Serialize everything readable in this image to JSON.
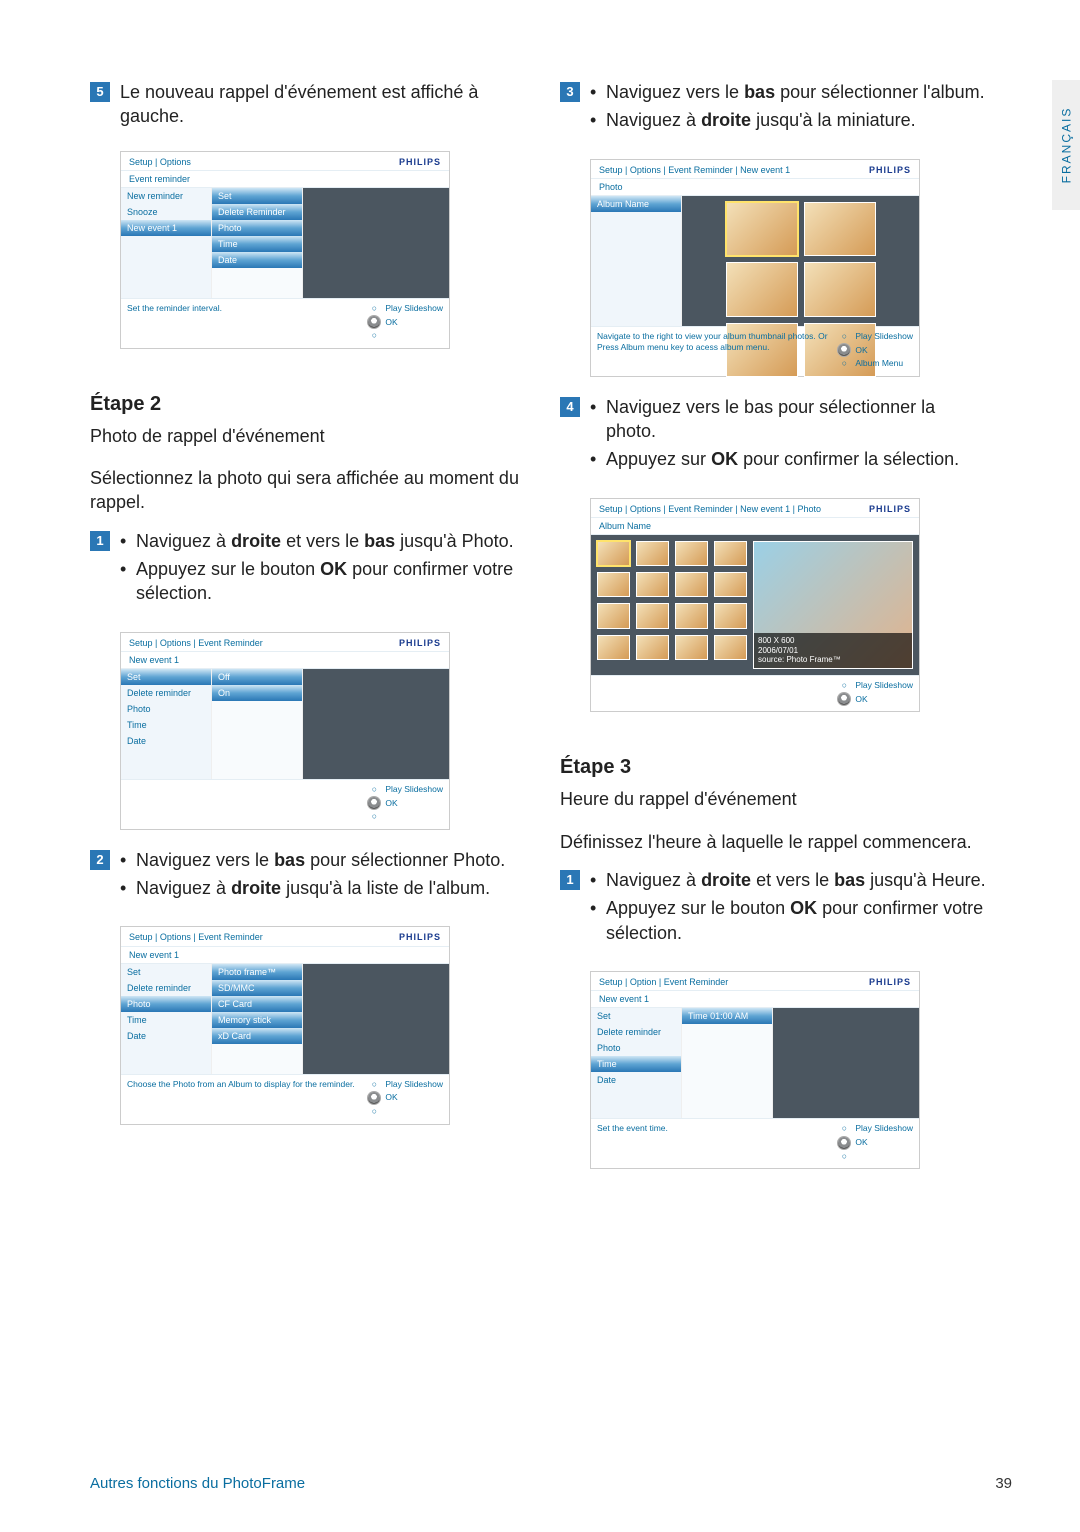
{
  "language_tab": "FRANÇAIS",
  "brand": "PHILIPS",
  "footer": {
    "left": "Autres fonctions du PhotoFrame",
    "page": "39"
  },
  "leftcol": {
    "step5_badge": "5",
    "step5_text": "Le nouveau rappel d'événement est affiché à gauche.",
    "etape2_title": "Étape 2",
    "etape2_sub": "Photo de rappel d'événement",
    "etape2_body": "Sélectionnez la photo qui sera affichée au moment du rappel.",
    "s2_1_badge": "1",
    "s2_1_li1_prefix": "Naviguez à ",
    "s2_1_li1_b1": "droite",
    "s2_1_li1_mid": " et vers le ",
    "s2_1_li1_b2": "bas",
    "s2_1_li1_suffix": " jusqu'à Photo.",
    "s2_1_li2_prefix": "Appuyez sur le bouton ",
    "s2_1_li2_b": "OK",
    "s2_1_li2_suffix": " pour confirmer votre sélection.",
    "s2_2_badge": "2",
    "s2_2_li1_prefix": "Naviguez vers le ",
    "s2_2_li1_b": "bas",
    "s2_2_li1_suffix": " pour sélectionner Photo.",
    "s2_2_li2_prefix": "Naviguez à ",
    "s2_2_li2_b": "droite",
    "s2_2_li2_suffix": " jusqu'à la liste de l'album.",
    "shot1": {
      "crumb": "Setup | Options",
      "row": "Event reminder",
      "p1_0": "New reminder",
      "p1_1": "Snooze",
      "p1_2": "New event 1",
      "p2_0": "Set",
      "p2_1": "Delete Reminder",
      "p2_2": "Photo",
      "p2_3": "Time",
      "p2_4": "Date",
      "hint": "Set the reminder interval.",
      "ctrl1": "Play Slideshow",
      "ctrl2": "OK"
    },
    "shot2": {
      "crumb": "Setup | Options | Event Reminder",
      "row": "New event 1",
      "p1_0": "Set",
      "p1_1": "Delete reminder",
      "p1_2": "Photo",
      "p1_3": "Time",
      "p1_4": "Date",
      "p2_0": "Off",
      "p2_1": "On",
      "hint": "",
      "ctrl1": "Play Slideshow",
      "ctrl2": "OK"
    },
    "shot3": {
      "crumb": "Setup | Options | Event Reminder",
      "row": "New event 1",
      "p1_0": "Set",
      "p1_1": "Delete reminder",
      "p1_2": "Photo",
      "p1_3": "Time",
      "p1_4": "Date",
      "p2_0": "Photo frame™",
      "p2_1": "SD/MMC",
      "p2_2": "CF Card",
      "p2_3": "Memory stick",
      "p2_4": "xD Card",
      "hint": "Choose the Photo from an Album to display for the reminder.",
      "ctrl1": "Play Slideshow",
      "ctrl2": "OK"
    }
  },
  "rightcol": {
    "s3_badge": "3",
    "s3_li1_prefix": "Naviguez vers le ",
    "s3_li1_b": "bas",
    "s3_li1_suffix": " pour sélectionner l'album.",
    "s3_li2_prefix": "Naviguez à ",
    "s3_li2_b": "droite",
    "s3_li2_suffix": " jusqu'à la miniature.",
    "s4_badge": "4",
    "s4_li1": "Naviguez vers le bas pour sélectionner la photo.",
    "s4_li2_prefix": "Appuyez sur ",
    "s4_li2_b": "OK",
    "s4_li2_suffix": " pour confirmer la sélection.",
    "etape3_title": "Étape 3",
    "etape3_sub": "Heure du rappel d'événement",
    "etape3_body": "Définissez l'heure à laquelle le rappel commencera.",
    "s3_1_badge": "1",
    "s3_1_li1_prefix": "Naviguez à ",
    "s3_1_li1_b1": "droite",
    "s3_1_li1_mid": " et vers le ",
    "s3_1_li1_b2": "bas",
    "s3_1_li1_suffix": " jusqu'à Heure.",
    "s3_1_li2_prefix": "Appuyez sur le bouton ",
    "s3_1_li2_b": "OK",
    "s3_1_li2_suffix": " pour confirmer votre sélection.",
    "shot4": {
      "crumb": "Setup | Options | Event Reminder | New event 1",
      "row": "Photo",
      "p1_0": "Album Name",
      "hint": "Navigate to the right to view your album thumbnail photos. Or Press Album menu key to acess album menu.",
      "ctrl1": "Play Slideshow",
      "ctrl2": "OK",
      "ctrl3": "Album Menu"
    },
    "shot5": {
      "crumb": "Setup | Options | Event Reminder | New event 1 | Photo",
      "row": "Album Name",
      "meta1": "800 X 600",
      "meta2": "2006/07/01",
      "meta3": "source: Photo Frame™",
      "ctrl1": "Play Slideshow",
      "ctrl2": "OK"
    },
    "shot6": {
      "crumb": "Setup | Option | Event Reminder",
      "row": "New event 1",
      "p1_0": "Set",
      "p1_1": "Delete reminder",
      "p1_2": "Photo",
      "p1_3": "Time",
      "p1_4": "Date",
      "p2_0": "Time  01:00 AM",
      "hint": "Set the event time.",
      "ctrl1": "Play Slideshow",
      "ctrl2": "OK"
    }
  }
}
